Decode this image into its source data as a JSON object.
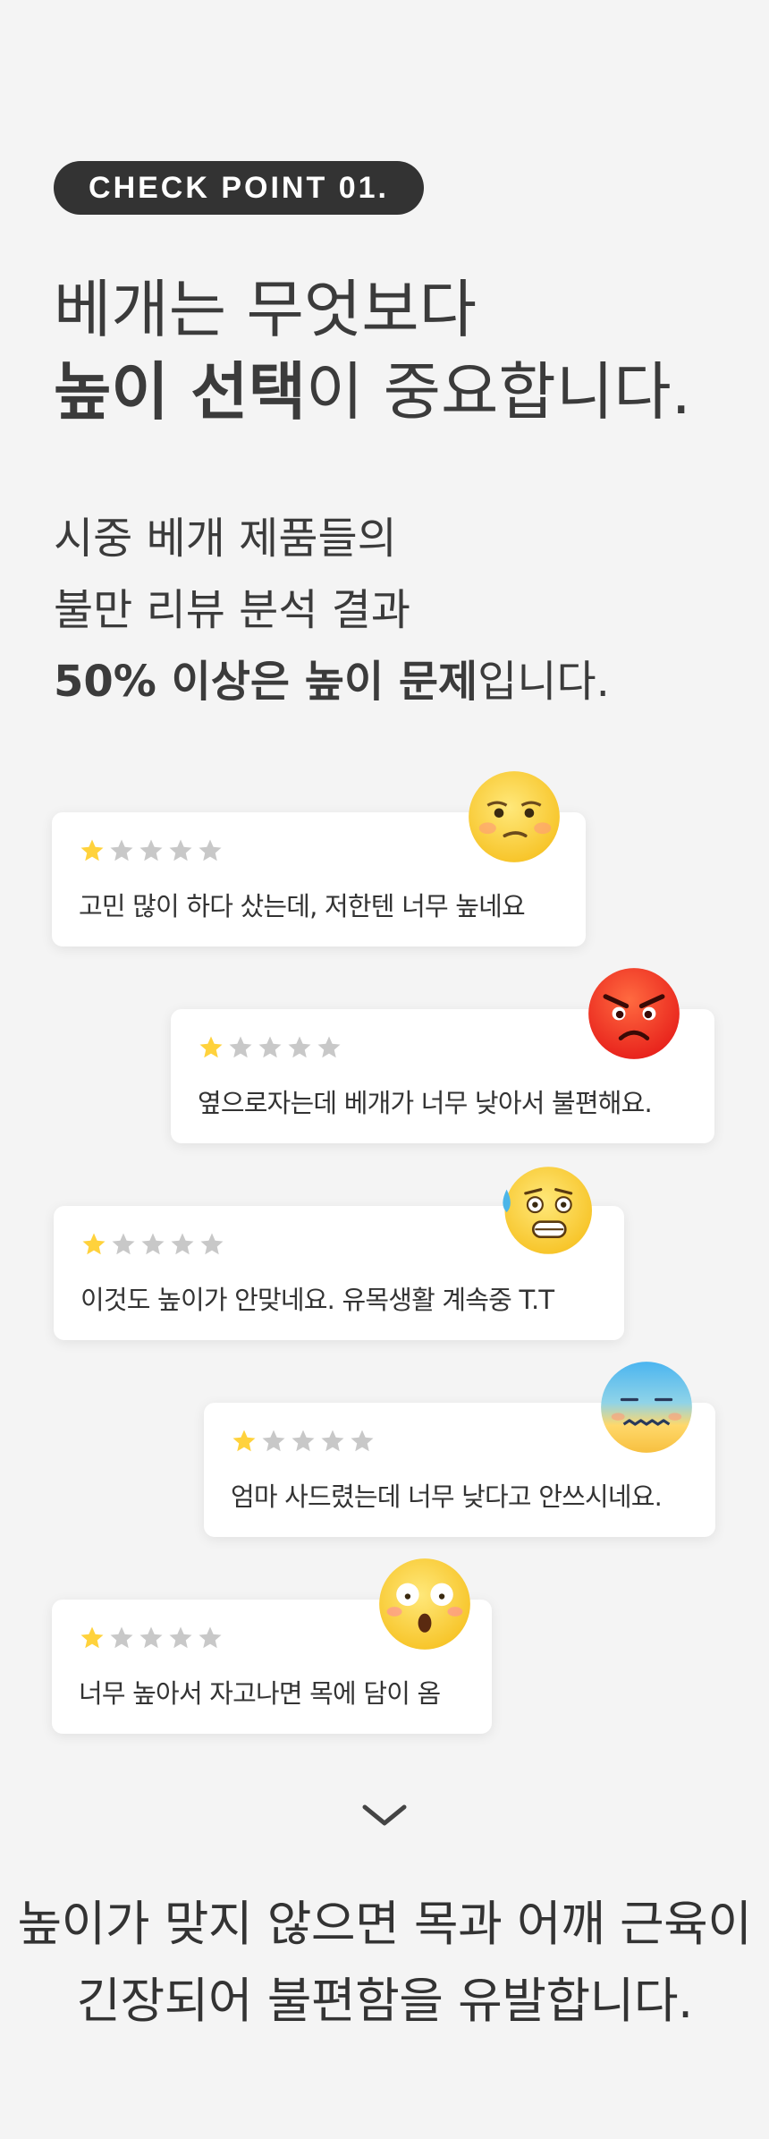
{
  "badge": "CHECK POINT 01.",
  "headline": {
    "line1": "베개는 무엇보다",
    "line2_bold": "높이 선택",
    "line2_rest": "이 중요합니다."
  },
  "sub": {
    "line1": "시중 베개 제품들의",
    "line2": "불만 리뷰 분석 결과",
    "line3_bold": "50% 이상은 높이 문제",
    "line3_rest": "입니다."
  },
  "reviews": [
    {
      "rating": 1,
      "max": 5,
      "text": "고민 많이 하다 샀는데, 저한텐 너무 높네요",
      "emoji": "worried-face-icon"
    },
    {
      "rating": 1,
      "max": 5,
      "text": "옆으로자는데 베개가 너무 낮아서 불편해요.",
      "emoji": "angry-face-icon"
    },
    {
      "rating": 1,
      "max": 5,
      "text": "이것도 높이가 안맞네요. 유목생활 계속중 T.T",
      "emoji": "anxious-sweat-face-icon"
    },
    {
      "rating": 1,
      "max": 5,
      "text": "엄마 사드렸는데 너무 낮다고 안쓰시네요.",
      "emoji": "cold-face-icon"
    },
    {
      "rating": 1,
      "max": 5,
      "text": "너무 높아서 자고나면 목에 담이 옴",
      "emoji": "shocked-face-icon"
    }
  ],
  "colors": {
    "background": "#f4f4f4",
    "badge": "#333333",
    "star_active": "#ffd23c",
    "star_inactive": "#c8c8c8"
  },
  "bottom": {
    "line1": "높이가 맞지 않으면 목과 어깨 근육이",
    "line2": "긴장되어 불편함을 유발합니다."
  }
}
